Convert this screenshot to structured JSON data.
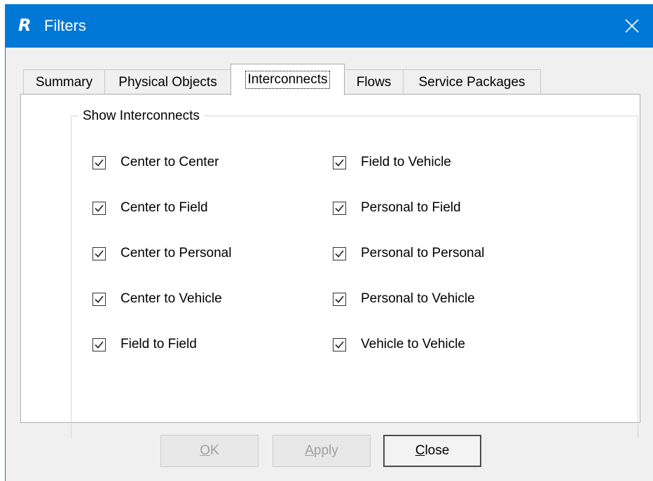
{
  "window": {
    "title": "Filters",
    "logo_letter": "R",
    "close_icon": "close-icon"
  },
  "tabs": [
    {
      "label": "Summary",
      "active": false
    },
    {
      "label": "Physical Objects",
      "active": false
    },
    {
      "label": "Interconnects",
      "active": true
    },
    {
      "label": "Flows",
      "active": false
    },
    {
      "label": "Service Packages",
      "active": false
    }
  ],
  "group": {
    "legend": "Show Interconnects",
    "left_column": [
      {
        "label": "Center to Center",
        "checked": true
      },
      {
        "label": "Center to Field",
        "checked": true
      },
      {
        "label": "Center to Personal",
        "checked": true
      },
      {
        "label": "Center to Vehicle",
        "checked": true
      },
      {
        "label": "Field to Field",
        "checked": true
      }
    ],
    "right_column": [
      {
        "label": "Field to Vehicle",
        "checked": true
      },
      {
        "label": "Personal to Field",
        "checked": true
      },
      {
        "label": "Personal to Personal",
        "checked": true
      },
      {
        "label": "Personal to Vehicle",
        "checked": true
      },
      {
        "label": "Vehicle to Vehicle",
        "checked": true
      }
    ]
  },
  "buttons": {
    "ok": {
      "mnemonic": "O",
      "rest": "K",
      "enabled": false
    },
    "apply": {
      "mnemonic": "A",
      "rest": "pply",
      "enabled": false
    },
    "close": {
      "mnemonic": "C",
      "rest": "lose",
      "enabled": true
    }
  },
  "colors": {
    "titlebar": "#0078d7",
    "window_bg": "#f0f0f0",
    "panel_bg": "#ffffff"
  }
}
